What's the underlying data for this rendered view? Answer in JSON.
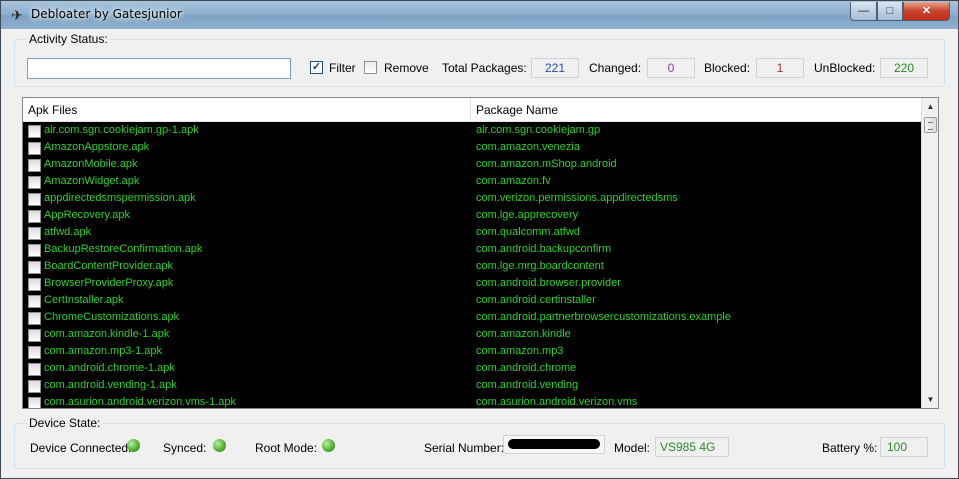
{
  "window": {
    "title": "Debloater by Gatesjunior",
    "buttons": {
      "minimize": "—",
      "maximize": "□",
      "close": "✕"
    }
  },
  "activity": {
    "group_label": "Activity Status:",
    "status_value": "",
    "filter": {
      "label": "Filter",
      "checked": true
    },
    "remove": {
      "label": "Remove",
      "checked": false
    },
    "total_label": "Total Packages:",
    "total_value": "221",
    "changed_label": "Changed:",
    "changed_value": "0",
    "blocked_label": "Blocked:",
    "blocked_value": "1",
    "unblocked_label": "UnBlocked:",
    "unblocked_value": "220"
  },
  "list": {
    "headers": {
      "apk": "Apk Files",
      "package": "Package Name"
    },
    "rows": [
      {
        "apk": "air.com.sgn.cookiejam.gp-1.apk",
        "package": "air.com.sgn.cookiejam.gp"
      },
      {
        "apk": "AmazonAppstore.apk",
        "package": "com.amazon.venezia"
      },
      {
        "apk": "AmazonMobile.apk",
        "package": "com.amazon.mShop.android"
      },
      {
        "apk": "AmazonWidget.apk",
        "package": "com.amazon.fv"
      },
      {
        "apk": "appdirectedsmspermission.apk",
        "package": "com.verizon.permissions.appdirectedsms"
      },
      {
        "apk": "AppRecovery.apk",
        "package": "com.lge.apprecovery"
      },
      {
        "apk": "atfwd.apk",
        "package": "com.qualcomm.atfwd"
      },
      {
        "apk": "BackupRestoreConfirmation.apk",
        "package": "com.android.backupconfirm"
      },
      {
        "apk": "BoardContentProvider.apk",
        "package": "com.lge.mrg.boardcontent"
      },
      {
        "apk": "BrowserProviderProxy.apk",
        "package": "com.android.browser.provider"
      },
      {
        "apk": "CertInstaller.apk",
        "package": "com.android.certinstaller"
      },
      {
        "apk": "ChromeCustomizations.apk",
        "package": "com.android.partnerbrowsercustomizations.example"
      },
      {
        "apk": "com.amazon.kindle-1.apk",
        "package": "com.amazon.kindle"
      },
      {
        "apk": "com.amazon.mp3-1.apk",
        "package": "com.amazon.mp3"
      },
      {
        "apk": "com.android.chrome-1.apk",
        "package": "com.android.chrome"
      },
      {
        "apk": "com.android.vending-1.apk",
        "package": "com.android.vending"
      },
      {
        "apk": "com.asurion.android.verizon.vms-1.apk",
        "package": "com.asurion.android.verizon.vms"
      }
    ]
  },
  "device": {
    "group_label": "Device State:",
    "connected_label": "Device Connected:",
    "synced_label": "Synced:",
    "root_label": "Root Mode:",
    "serial_label": "Serial Number:",
    "model_label": "Model:",
    "model_value": "VS985 4G",
    "battery_label": "Battery %:",
    "battery_value": "100"
  },
  "colors": {
    "list_text": "#2bd22b",
    "total_value": "#2a4fa8",
    "changed_value": "#8a3aa8",
    "blocked_value": "#b02828",
    "unblocked_value": "#2c8a2c",
    "led": "#4caa2e"
  }
}
